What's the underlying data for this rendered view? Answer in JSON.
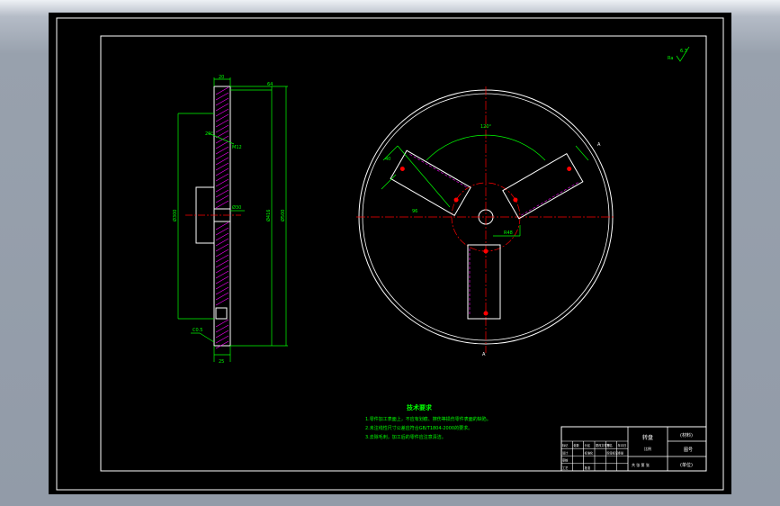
{
  "colors": {
    "background": "#000000",
    "frame": "#ffffff",
    "dimension": "#00ff00",
    "centerline": "#ff0000",
    "hatch": "#ff00ff",
    "note_text": "#00ff00",
    "chrome": "#98a1ad"
  },
  "side_view": {
    "dim_top": "20",
    "dim_top_right": "64",
    "dim_bottom": "25",
    "dim_left_height": "Ø300",
    "dim_mid_height": "Ø416",
    "dim_right_height": "Ø500",
    "dim_small_a": "20°",
    "dim_small_b": "M12",
    "dim_bore": "Ø30",
    "chamfer": "C0.5"
  },
  "front_view": {
    "angle_label": "120°",
    "slot_width": "40",
    "slot_length": "96",
    "radius_label": "R48",
    "section_mark": "A"
  },
  "roughness": {
    "symbol": "Ra",
    "value": "6.3"
  },
  "notes": {
    "title": "技术要求",
    "lines": [
      "1.零件加工表面上，不应有划痕、擦伤等损伤零件表面的缺陷。",
      "2.未注线性尺寸公差应符合GB/T1804-2000的要求。",
      "3.去除毛刺，加工后的零件应注意清洁。"
    ]
  },
  "title_block": {
    "part_name": "转盘",
    "material": "(材料)",
    "drawing_no": "图号",
    "scale": "比例",
    "sheet": "共 张 第 张",
    "company": "(单位)",
    "rows": [
      [
        "标记",
        "处数",
        "分区",
        "更改文件号",
        "签名",
        "年月日"
      ],
      [
        "设计",
        "",
        "标准化",
        "",
        "阶段标记",
        "重量"
      ],
      [
        "审核",
        "",
        "",
        "",
        "",
        ""
      ],
      [
        "工艺",
        "",
        "批准",
        "",
        "",
        ""
      ]
    ]
  }
}
